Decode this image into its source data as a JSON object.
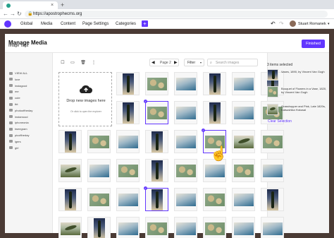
{
  "browser": {
    "url": "https://apostrophecms.org",
    "new_tab": "+",
    "tab_close": "×",
    "back": "←",
    "forward": "→",
    "reload": "↻",
    "lock": "🔒"
  },
  "appbar": {
    "menu": [
      "Global",
      "Media",
      "Content",
      "Page Settings",
      "Categories"
    ],
    "add_label": "+",
    "undo": "↶",
    "redo": "↷",
    "user_name": "Stuart Romanek",
    "user_caret": "▾"
  },
  "modal": {
    "title": "Manage Media",
    "finished_label": "Finished"
  },
  "tags": {
    "heading": "Image Tags",
    "items": [
      "VIEW ALL",
      "love",
      "instagood",
      "me",
      "cute",
      "tbt",
      "photooftheday",
      "instamood",
      "iphoneonia",
      "tweegram",
      "picoftheday",
      "igers",
      "girl"
    ]
  },
  "toolbar": {
    "checkbox": "☐",
    "video": "▭",
    "trash": "🗑",
    "more": "⋮",
    "prev": "◀",
    "next": "▶",
    "page_label": "Page 2",
    "filter_label": "Filter",
    "filter_caret": "▾",
    "search_icon": "⌕",
    "search_placeholder": "Search images"
  },
  "dropzone": {
    "title": "Drop new images here",
    "subtitle": "Or click to open the explorer"
  },
  "selected": {
    "count_label": "3 items selected",
    "check": "✓",
    "items": [
      {
        "label": "Vases, 1890, by Vincent Van Gogh"
      },
      {
        "label": "Bouquet of Flowers in a Vase, 1820, by Vincent Van Gogh"
      },
      {
        "label": "Grasshopper and Pink, Late 1820s, Katsushika Hokusai"
      }
    ],
    "clear_label": "Clear Selection"
  },
  "cursor": "☝",
  "accent_color": "#6236ff"
}
